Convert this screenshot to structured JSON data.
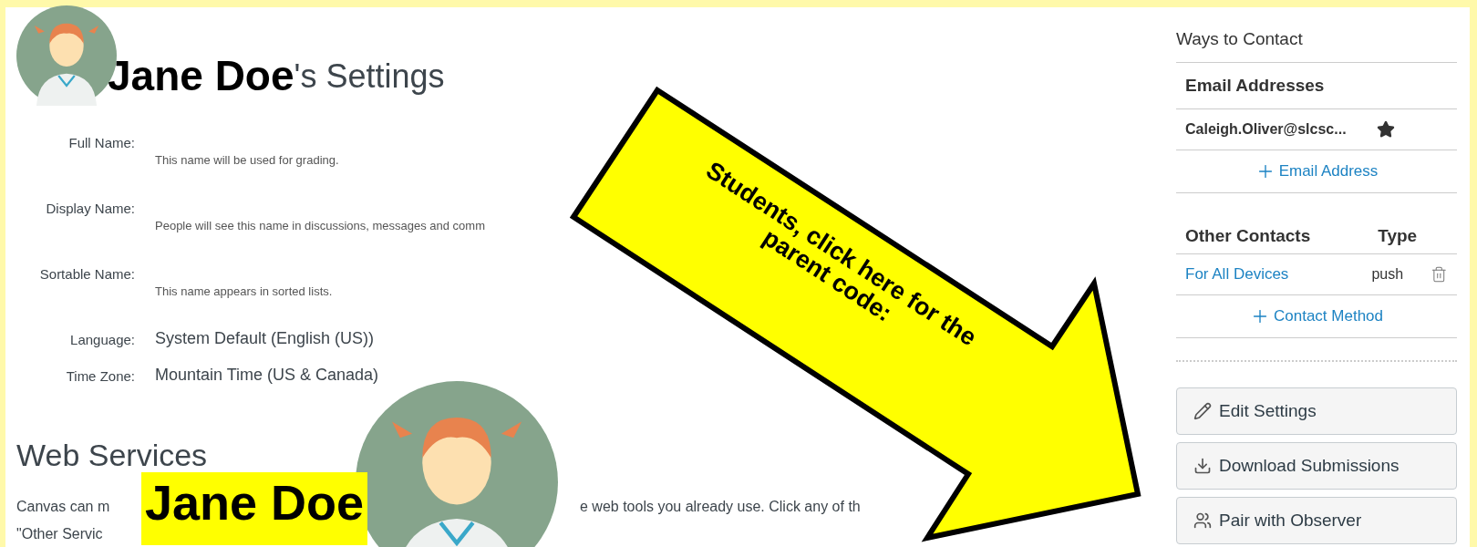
{
  "title": {
    "name_overlay": "Jane Doe",
    "suffix": "'s Settings"
  },
  "profile_fields": [
    {
      "label": "Full Name:",
      "hint": "This name will be used for grading."
    },
    {
      "label": "Display Name:",
      "hint": "People will see this name in discussions, messages and comm"
    },
    {
      "label": "Sortable Name:",
      "hint": "This name appears in sorted lists."
    },
    {
      "label": "Language:",
      "value": "System Default (English (US))"
    },
    {
      "label": "Time Zone:",
      "value": "Mountain Time (US & Canada)"
    }
  ],
  "web_services": {
    "heading": "Web Services",
    "line_1_parts": [
      "Canvas can m",
      "e web tools you already use. Click any of th"
    ],
    "line_2_parts": [
      "\"Other Servic"
    ]
  },
  "overlays": {
    "name_label": "Jane Doe",
    "callout_lines": [
      "Students, click here for the",
      "parent code:"
    ]
  },
  "sidebar": {
    "heading": "Ways to Contact",
    "email_section": {
      "heading": "Email Addresses",
      "emails": [
        {
          "address": "Caleigh.Oliver@slcsc...",
          "default": true
        }
      ],
      "add_link": "Email Address"
    },
    "contacts_section": {
      "columns": [
        "Other Contacts",
        "Type"
      ],
      "contacts": [
        {
          "name": "For All Devices",
          "type": "push"
        }
      ],
      "add_link": "Contact Method"
    },
    "buttons": [
      {
        "kind": "edit",
        "label": "Edit Settings"
      },
      {
        "kind": "download",
        "label": "Download Submissions"
      },
      {
        "kind": "pair",
        "label": "Pair with Observer"
      }
    ]
  }
}
